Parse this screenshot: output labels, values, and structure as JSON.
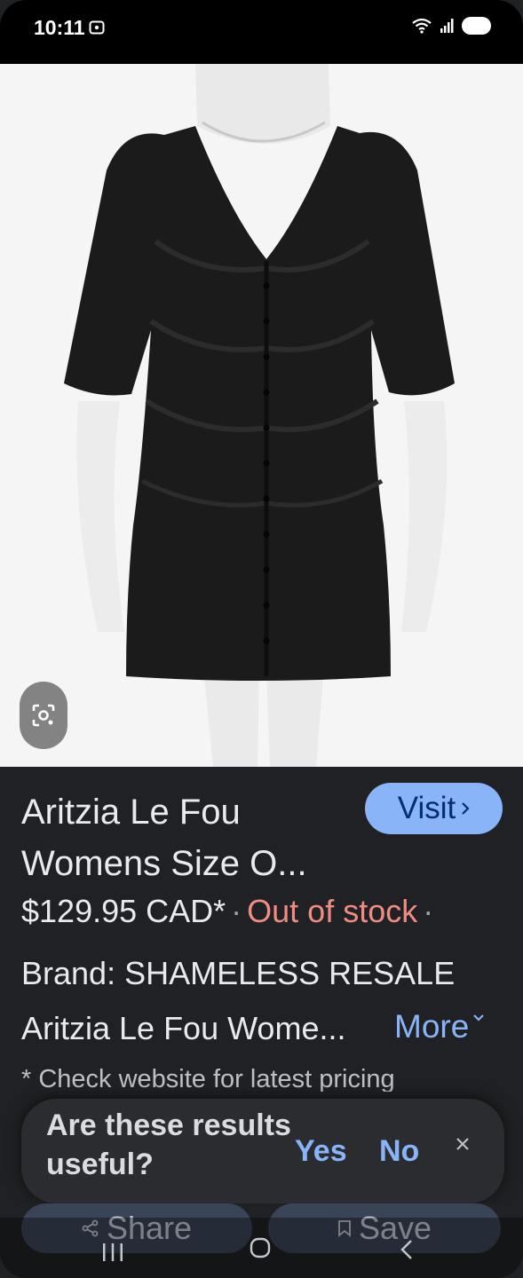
{
  "status_bar": {
    "time": "10:11"
  },
  "product": {
    "title": "Aritzia Le Fou Womens Size O...",
    "visit_label": "Visit",
    "price": "$129.95 CAD*",
    "separator": "·",
    "stock_status": "Out of stock",
    "brand": "Brand: SHAMELESS RESALE",
    "description": "Aritzia Le Fou Wome...",
    "more_label": "More",
    "pricing_note": "* Check website for latest pricing"
  },
  "feedback": {
    "question": "Are these results useful?",
    "yes_label": "Yes",
    "no_label": "No"
  },
  "actions": {
    "share_label": "Share",
    "save_label": "Save"
  },
  "colors": {
    "accent": "#8ab4f8",
    "out_of_stock": "#f28b82",
    "background": "#202124",
    "action_button": "#394457"
  },
  "icons": [
    "lens-icon",
    "chevron-right-icon",
    "chevron-down-icon",
    "close-icon",
    "share-icon",
    "bookmark-icon",
    "wifi-icon",
    "signal-icon",
    "battery-icon",
    "screen-record-icon",
    "nav-recents-icon",
    "nav-home-icon",
    "nav-back-icon"
  ]
}
